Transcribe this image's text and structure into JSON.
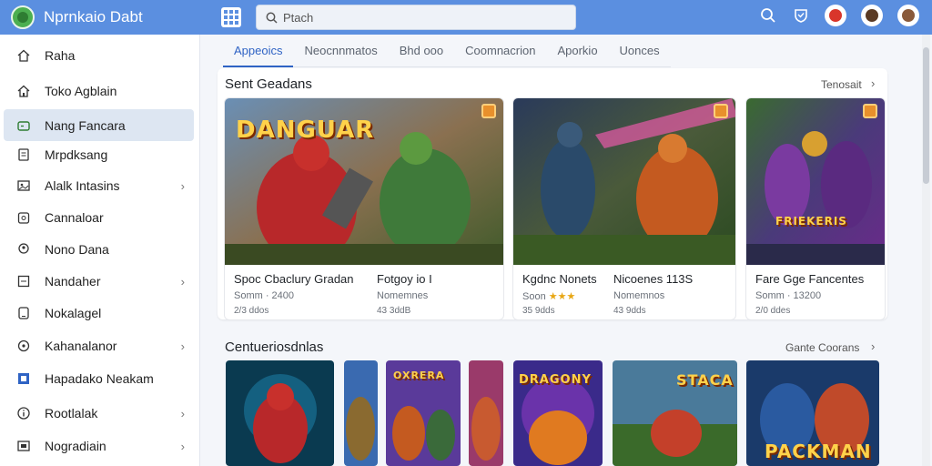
{
  "app": {
    "title": "Nprnkaio Dabt",
    "search_placeholder": "Ptach"
  },
  "topbar": {
    "icons": [
      "search-icon",
      "shield-icon",
      "user-avatar-1",
      "user-avatar-2",
      "user-avatar-3"
    ]
  },
  "sidebar": {
    "items": [
      {
        "label": "Raha",
        "icon": "home-icon",
        "chevron": false,
        "active": false
      },
      {
        "label": "Toko Agblain",
        "icon": "home-outline-icon",
        "chevron": false,
        "active": false
      },
      {
        "label": "Nang Fancara",
        "icon": "gamepad-icon",
        "chevron": false,
        "active": true
      },
      {
        "label": "Mrpdksang",
        "icon": "document-icon",
        "chevron": false,
        "active": false
      },
      {
        "label": "Alalk Intasins",
        "icon": "image-icon",
        "chevron": true,
        "active": false
      },
      {
        "label": "Cannaloar",
        "icon": "calendar-icon",
        "chevron": false,
        "active": false
      },
      {
        "label": "Nono Dana",
        "icon": "user-icon",
        "chevron": false,
        "active": false
      },
      {
        "label": "Nandaher",
        "icon": "list-icon",
        "chevron": true,
        "active": false
      },
      {
        "label": "Nokalagel",
        "icon": "tablet-icon",
        "chevron": false,
        "active": false
      },
      {
        "label": "Kahanalanor",
        "icon": "target-icon",
        "chevron": true,
        "active": false
      },
      {
        "label": "Hapadako Neakam",
        "icon": "grid-icon",
        "chevron": false,
        "active": false
      },
      {
        "label": "Rootlalak",
        "icon": "info-icon",
        "chevron": true,
        "active": false
      },
      {
        "label": "Nogradiain",
        "icon": "image-frame-icon",
        "chevron": true,
        "active": false
      }
    ]
  },
  "tabs": [
    {
      "label": "Appeoics",
      "active": true
    },
    {
      "label": "Neocnnmatos",
      "active": false
    },
    {
      "label": "Bhd ooo",
      "active": false
    },
    {
      "label": "Coomnacrion",
      "active": false
    },
    {
      "label": "Aporkio",
      "active": false
    },
    {
      "label": "Uonces",
      "active": false
    }
  ],
  "section1": {
    "title": "Sent Geadans",
    "see_all": "Tenosait",
    "cards": [
      {
        "art_title": "DANGUAR",
        "name": "Spoc Cbaclury Gradan",
        "meta": "Somm · 2400",
        "sub": "2/3 ddos",
        "name2": "Fotgoy io I",
        "meta2": "Nomemnes",
        "sub2": "43 3ddB"
      },
      {
        "art_title": "",
        "name": "Kgdnc Nonets",
        "meta": "Soon",
        "sub": "35 9dds",
        "name2": "Nicoenes 113S",
        "meta2": "Nomemnos",
        "sub2": "43 9dds",
        "rating_stars": "★★★"
      },
      {
        "art_title": "FRIEKERIS",
        "name": "Fare Gge Fancentes",
        "meta": "Somm · 13200",
        "sub": "2/0 ddes",
        "name2": "",
        "meta2": "",
        "sub2": ""
      }
    ]
  },
  "section2": {
    "title": "Centueriosdnlas",
    "see_all": "Gante Coorans",
    "tiles": [
      {
        "art_title": ""
      },
      {
        "art_title": ""
      },
      {
        "art_title": "OXRERA"
      },
      {
        "art_title": ""
      },
      {
        "art_title": "DRAGONY"
      },
      {
        "art_title": "STACA"
      },
      {
        "art_title": "PACKMAN"
      }
    ]
  }
}
